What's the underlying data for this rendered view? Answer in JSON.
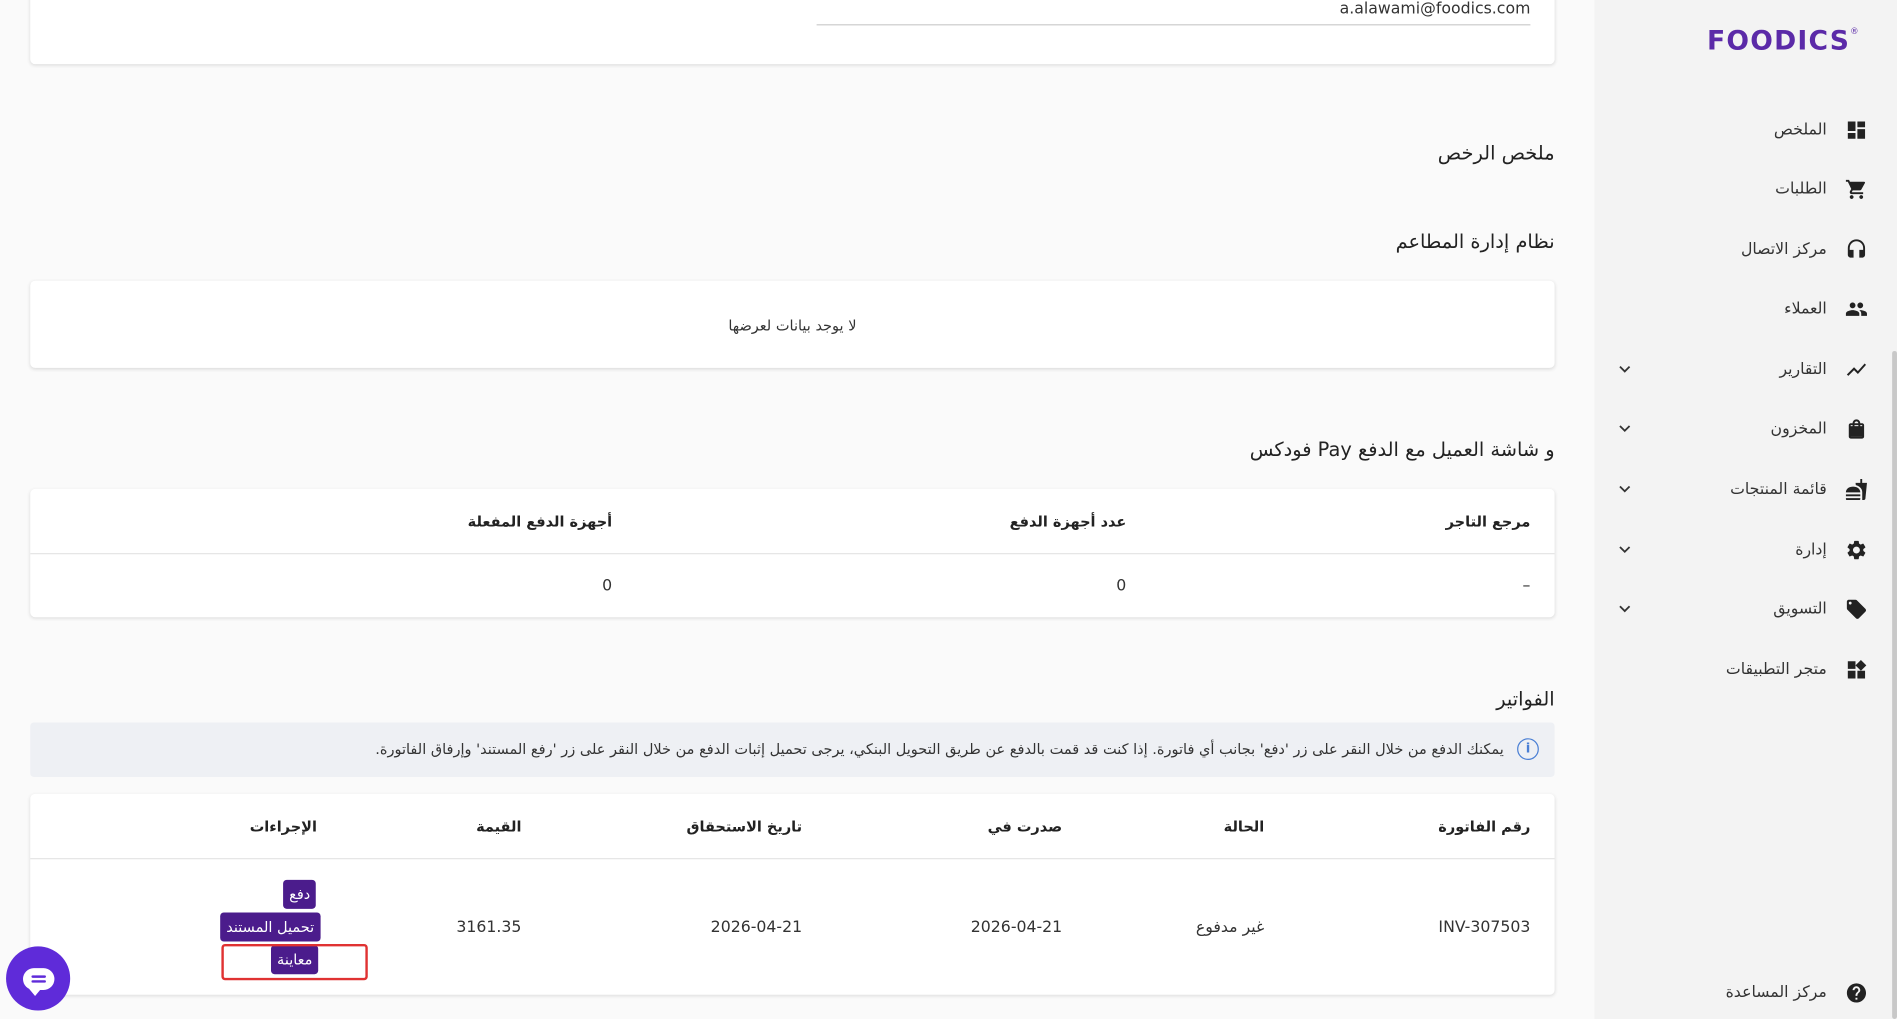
{
  "brand": {
    "logo_text": "FOODICS",
    "logo_mark": "®",
    "accent": "#4b1c8c"
  },
  "sidebar": {
    "items": [
      {
        "label": "الملخص",
        "icon": "dashboard-icon",
        "expandable": false
      },
      {
        "label": "الطلبات",
        "icon": "cart-icon",
        "expandable": false
      },
      {
        "label": "مركز الاتصال",
        "icon": "headset-icon",
        "expandable": false
      },
      {
        "label": "العملاء",
        "icon": "people-icon",
        "expandable": false
      },
      {
        "label": "التقارير",
        "icon": "trending-icon",
        "expandable": true
      },
      {
        "label": "المخزون",
        "icon": "bag-icon",
        "expandable": true
      },
      {
        "label": "قائمة المنتجات",
        "icon": "menu-food-icon",
        "expandable": true
      },
      {
        "label": "إدارة",
        "icon": "gear-icon",
        "expandable": true
      },
      {
        "label": "التسويق",
        "icon": "tag-icon",
        "expandable": true
      },
      {
        "label": "متجر التطبيقات",
        "icon": "apps-icon",
        "expandable": false
      }
    ],
    "help": {
      "label": "مركز المساعدة",
      "icon": "help-icon"
    }
  },
  "account": {
    "email": "a.alawami@foodics.com"
  },
  "licenses": {
    "title": "ملخص الرخص",
    "restaurant_system": {
      "title": "نظام إدارة المطاعم",
      "empty_text": "لا يوجد بيانات لعرضها"
    },
    "pay": {
      "title": "فودكس Pay و شاشة العميل مع الدفع",
      "headers": [
        "مرجع التاجر",
        "عدد أجهزة الدفع",
        "أجهزة الدفع المفعلة"
      ],
      "row": [
        "–",
        "0",
        "0"
      ]
    }
  },
  "invoices": {
    "title": "الفواتير",
    "info": "يمكنك الدفع من خلال النقر على زر 'دفع' بجانب أي فاتورة. إذا كنت قد قمت بالدفع عن طريق التحويل البنكي، يرجى تحميل إثبات الدفع من خلال النقر على زر 'رفع المستند' وإرفاق الفاتورة.",
    "headers": [
      "رقم الفاتورة",
      "الحالة",
      "صدرت في",
      "تاريخ الاستحقاق",
      "القيمة",
      "الإجراءات"
    ],
    "rows": [
      {
        "number": "INV-307503",
        "status": "غير مدفوع",
        "issued": "2026-04-21",
        "due": "2026-04-21",
        "amount": "3161.35",
        "actions": {
          "pay": "دفع",
          "download": "تحميل المستند",
          "preview": "معاينة"
        }
      }
    ]
  }
}
